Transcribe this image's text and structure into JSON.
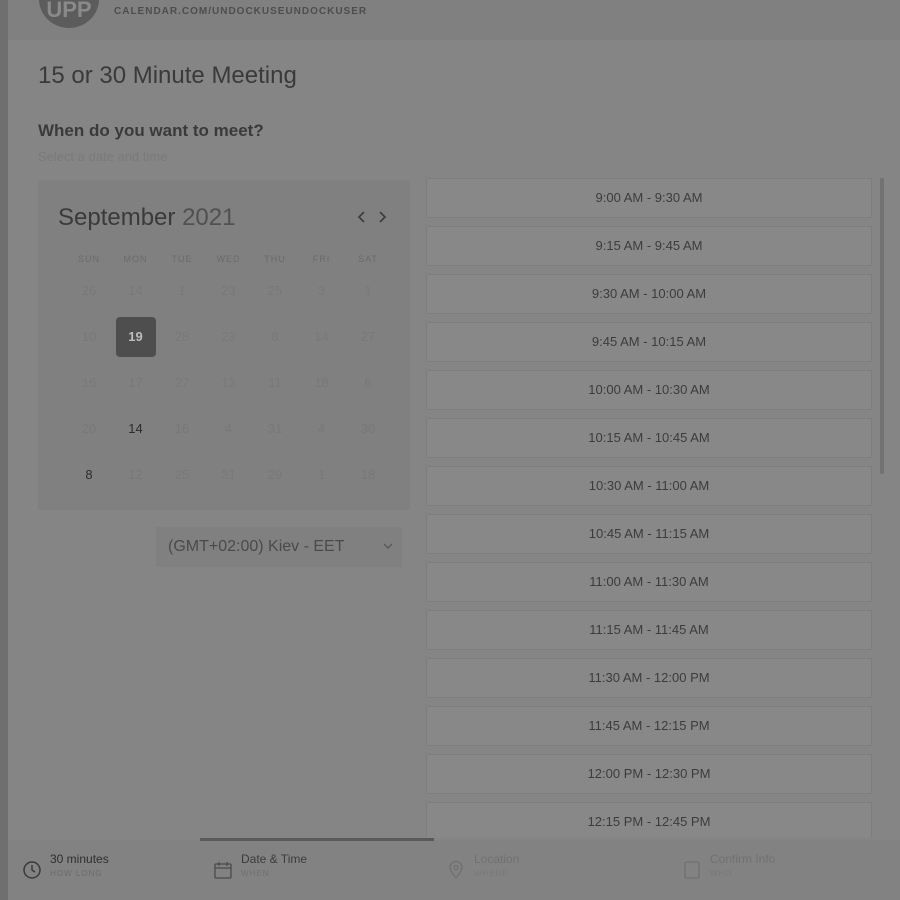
{
  "header": {
    "avatar_initials": "UPP",
    "link": "CALENDAR.COM/UNDOCKUSEUNDOCKUSER"
  },
  "meeting": {
    "title": "15 or 30 Minute Meeting",
    "question": "When do you want to meet?",
    "subtitle": "Select a date and time"
  },
  "calendar": {
    "month": "September",
    "year": "2021",
    "prev_icon": "chevron-left-icon",
    "next_icon": "chevron-right-icon",
    "weekdays": [
      "SUN",
      "MON",
      "TUE",
      "WED",
      "THU",
      "FRI",
      "SAT"
    ],
    "weeks": [
      [
        "26",
        "14",
        "1",
        "23",
        "25",
        "3",
        "1"
      ],
      [
        "10",
        "19",
        "28",
        "23",
        "8",
        "14",
        "27"
      ],
      [
        "16",
        "17",
        "27",
        "13",
        "11",
        "18",
        "6"
      ],
      [
        "20",
        "14",
        "16",
        "4",
        "31",
        "4",
        "30"
      ],
      [
        "8",
        "12",
        "25",
        "31",
        "29",
        "1",
        "18"
      ]
    ],
    "selected_day": "19",
    "available_days": [
      "14",
      "8"
    ]
  },
  "timezone": {
    "value": "(GMT+02:00) Kiev - EET",
    "icon": "chevron-down-icon"
  },
  "slots": [
    "9:00 AM - 9:30 AM",
    "9:15 AM - 9:45 AM",
    "9:30 AM - 10:00 AM",
    "9:45 AM - 10:15 AM",
    "10:00 AM - 10:30 AM",
    "10:15 AM - 10:45 AM",
    "10:30 AM - 11:00 AM",
    "10:45 AM - 11:15 AM",
    "11:00 AM - 11:30 AM",
    "11:15 AM - 11:45 AM",
    "11:30 AM - 12:00 PM",
    "11:45 AM - 12:15 PM",
    "12:00 PM - 12:30 PM",
    "12:15 PM - 12:45 PM"
  ],
  "footer": {
    "steps": [
      {
        "label": "30 minutes",
        "sub": "HOW LONG",
        "icon": "clock-icon"
      },
      {
        "label": "Date & Time",
        "sub": "WHEN",
        "icon": "calendar-icon"
      },
      {
        "label": "Location",
        "sub": "WHERE",
        "icon": "location-pin-icon"
      },
      {
        "label": "Confirm Info",
        "sub": "WHO",
        "icon": "document-icon"
      }
    ]
  },
  "colors": {
    "selected_day_bg": "#4e4e4e",
    "overlay_bg": "#858585"
  }
}
